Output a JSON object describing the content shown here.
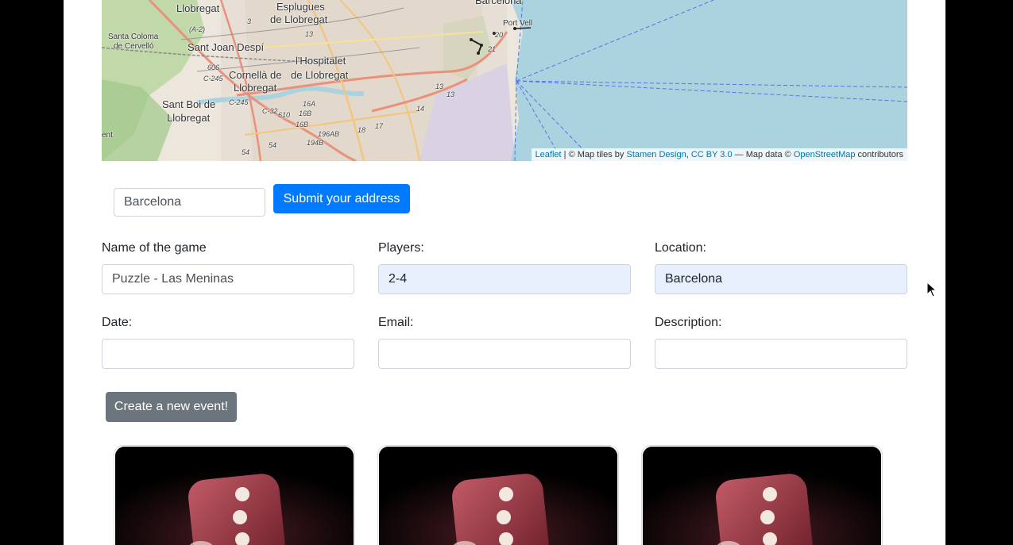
{
  "map": {
    "labels": {
      "llobregat_top": "Llobregat",
      "esplugues": "Esplugues",
      "de_llobregat": "de Llobregat",
      "barcelona": "Barcelona",
      "port_vell": "Port Vell",
      "santa_coloma": "Santa Coloma",
      "de_cervello": "de Cervelló",
      "sant_joan_despi": "Sant Joan Despí",
      "lhospitalet": "l'Hospitalet",
      "de_llobregat_2": "de Llobregat",
      "cornella": "Cornellà de",
      "llobregat_mid": "Llobregat",
      "sant_boi": "Sant Boi de",
      "llobregat_low": "Llobregat",
      "ent": "ent",
      "road_a2": "(A-2)",
      "road_606": "606",
      "road_c245": "C-245",
      "road_c32": "C-32",
      "road_610": "610",
      "road_16a": "16A",
      "road_16b": "16B",
      "road_194b": "194B",
      "road_196ab": "196AB",
      "road_13": "13",
      "road_14": "14",
      "road_17": "17",
      "road_18": "18",
      "road_20": "20",
      "road_21": "21",
      "road_3": "3",
      "road_54": "54"
    },
    "attribution": {
      "leaflet": "Leaflet",
      "sep1": " | © Map tiles by ",
      "stamen": "Stamen Design",
      "comma": ", ",
      "ccby": "CC BY 3.0",
      "mid": " — Map data © ",
      "osm": "OpenStreetMap",
      "end": " contributors"
    },
    "colors": {
      "sea": "#aad3df",
      "land": "#ece6dc",
      "park": "#a8d08d"
    }
  },
  "address": {
    "value": "Barcelona",
    "submit_label": "Submit your address"
  },
  "form": {
    "name_label": "Name of the game",
    "name_value": "Puzzle - Las Meninas",
    "players_label": "Players:",
    "players_value": "2-4",
    "location_label": "Location:",
    "location_value": "Barcelona",
    "date_label": "Date:",
    "date_value": "",
    "email_label": "Email:",
    "email_value": "",
    "description_label": "Description:",
    "description_value": ""
  },
  "create_label": "Create a new event!",
  "cards": [
    {
      "image": "red-dice-image"
    },
    {
      "image": "red-dice-image"
    },
    {
      "image": "red-dice-image"
    }
  ],
  "colors": {
    "primary": "#007bff",
    "secondary": "#6c757d",
    "autofill": "#e8f0fe"
  }
}
